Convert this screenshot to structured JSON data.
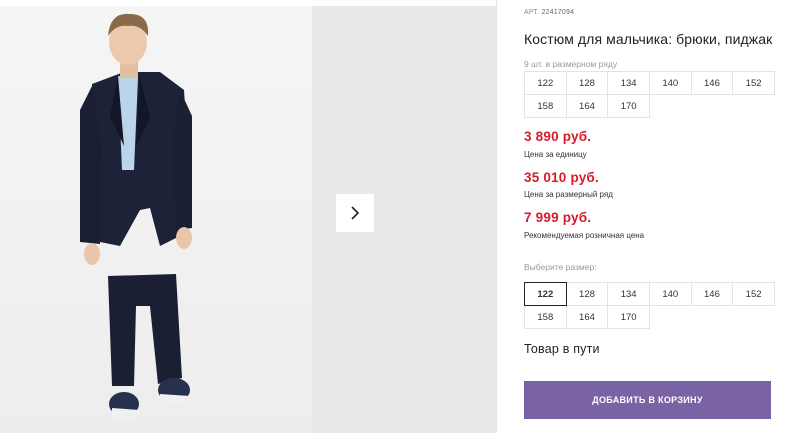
{
  "gallery": {
    "photo_subject": "boy-in-navy-suit",
    "next_icon": "chevron-right-icon"
  },
  "product": {
    "art_label": "АРТ.",
    "art_number": "22417094",
    "title": "Костюм для мальчика: брюки, пиджак",
    "pack_note": "9 шт. в размерном ряду",
    "pack_sizes": [
      "122",
      "128",
      "134",
      "140",
      "146",
      "152",
      "158",
      "164",
      "170"
    ],
    "prices": [
      {
        "value": "3 890 руб.",
        "caption": "Цена за единицу"
      },
      {
        "value": "35 010 руб.",
        "caption": "Цена за размерный ряд"
      },
      {
        "value": "7 999 руб.",
        "caption": "Рекомендуемая розничная цена"
      }
    ],
    "choose_size_label": "Выберите размер:",
    "sizes": [
      "122",
      "128",
      "134",
      "140",
      "146",
      "152",
      "158",
      "164",
      "170"
    ],
    "selected_size": "122",
    "status": "Товар в пути",
    "add_to_cart_label": "ДОБАВИТЬ В КОРЗИНУ"
  },
  "colors": {
    "price": "#d81b2b",
    "button": "#7a63a5",
    "suit": "#1c2238"
  }
}
